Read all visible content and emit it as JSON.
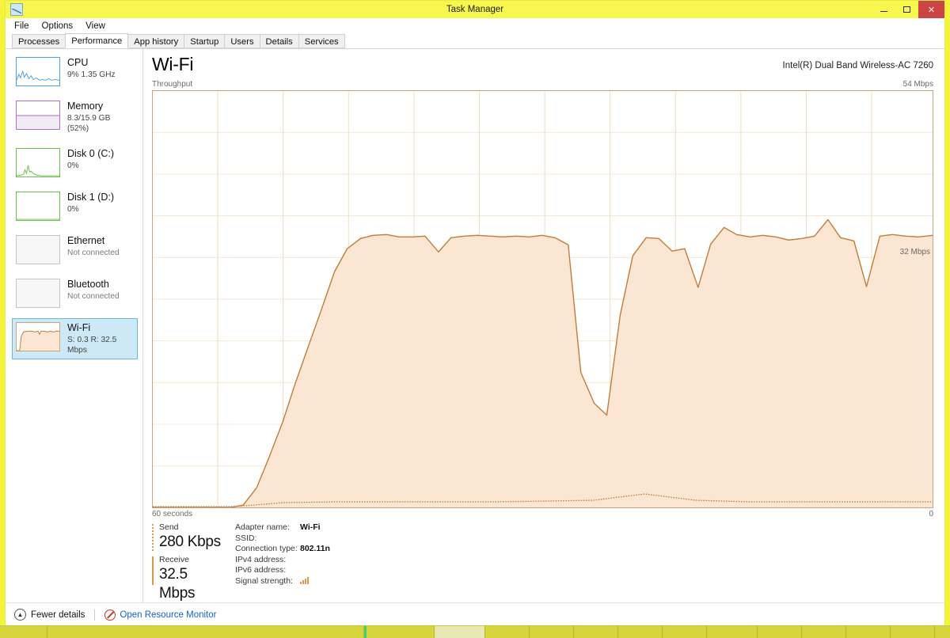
{
  "window": {
    "title": "Task Manager",
    "icon": "task-manager-icon",
    "minimize_label": "–",
    "maximize_label": "❑",
    "close_label": "✕"
  },
  "menu": {
    "items": [
      "File",
      "Options",
      "View"
    ]
  },
  "tabs": {
    "items": [
      "Processes",
      "Performance",
      "App history",
      "Startup",
      "Users",
      "Details",
      "Services"
    ],
    "active": "Performance"
  },
  "sidebar": {
    "items": [
      {
        "name": "CPU",
        "sub": "9%  1.35 GHz",
        "accent": "#4aa3df",
        "selected": false,
        "dim": false
      },
      {
        "name": "Memory",
        "sub": "8.3/15.9 GB (52%)",
        "accent": "#b06fc4",
        "selected": false,
        "dim": false
      },
      {
        "name": "Disk 0 (C:)",
        "sub": "0%",
        "accent": "#6abf4b",
        "selected": false,
        "dim": false
      },
      {
        "name": "Disk 1 (D:)",
        "sub": "0%",
        "accent": "#6abf4b",
        "selected": false,
        "dim": false
      },
      {
        "name": "Ethernet",
        "sub": "Not connected",
        "accent": "#bdbdbd",
        "selected": false,
        "dim": true
      },
      {
        "name": "Bluetooth",
        "sub": "Not connected",
        "accent": "#bdbdbd",
        "selected": false,
        "dim": true
      },
      {
        "name": "Wi-Fi",
        "sub": "S: 0.3 R: 32.5 Mbps",
        "accent": "#d99a4e",
        "selected": true,
        "dim": false
      }
    ]
  },
  "main": {
    "title": "Wi-Fi",
    "adapter": "Intel(R) Dual Band Wireless-AC 7260",
    "graph_caption_left": "Throughput",
    "graph_caption_right": "54 Mbps",
    "inline_label": "32 Mbps",
    "axis_left": "60 seconds",
    "axis_right": "0"
  },
  "stats": {
    "send": {
      "label": "Send",
      "value": "280 Kbps"
    },
    "receive": {
      "label": "Receive",
      "value": "32.5 Mbps"
    },
    "info": [
      {
        "key": "Adapter name:",
        "value": "Wi-Fi"
      },
      {
        "key": "SSID:",
        "value": ""
      },
      {
        "key": "Connection type:",
        "value": "802.11n"
      },
      {
        "key": "IPv4 address:",
        "value": ""
      },
      {
        "key": "IPv6 address:",
        "value": ""
      },
      {
        "key": "Signal strength:",
        "value": ""
      }
    ]
  },
  "statusbar": {
    "fewer_details": "Fewer details",
    "open_resource_monitor": "Open Resource Monitor"
  },
  "colors": {
    "line": "#c07c38",
    "fill": "#fbe6d4",
    "grid": "#f0dcc4",
    "border": "#c8a477",
    "accent_blue": "#1565c0",
    "selection": "#cde8f7",
    "titlebar": "#f7f74e",
    "close": "#cc4444"
  },
  "chart_data": {
    "type": "area",
    "title": "Throughput",
    "xlabel": "60 seconds",
    "ylabel": "Mbps",
    "ylim": [
      0,
      54
    ],
    "xlim": [
      0,
      60
    ],
    "grid": true,
    "legend": "none",
    "annotations": [
      {
        "text": "54 Mbps",
        "position": "top-right"
      },
      {
        "text": "32 Mbps",
        "position": "right",
        "value": 32
      },
      {
        "text": "60 seconds",
        "position": "bottom-left"
      },
      {
        "text": "0",
        "position": "bottom-right"
      }
    ],
    "series": [
      {
        "name": "Receive",
        "style": "area",
        "color": "#c07c38",
        "fill": "#fbe6d4",
        "x": [
          0,
          1,
          2,
          3,
          4,
          5,
          6,
          7,
          8,
          9,
          10,
          11,
          12,
          13,
          14,
          15,
          16,
          17,
          18,
          19,
          20,
          21,
          22,
          23,
          24,
          25,
          26,
          27,
          28,
          29,
          30,
          31,
          32,
          33,
          34,
          35,
          36,
          37,
          38,
          39,
          40,
          41,
          42,
          43,
          44,
          45,
          46,
          47,
          48,
          49,
          50,
          51,
          52,
          53,
          54,
          55,
          56,
          57,
          58,
          59,
          60
        ],
        "values": [
          0,
          0,
          0,
          0,
          0,
          0,
          0,
          0.3,
          2.5,
          6.5,
          11,
          16,
          21,
          26.5,
          30.5,
          31.8,
          32.2,
          32.3,
          32.0,
          31.9,
          32.0,
          33.1,
          31.9,
          32.1,
          32.2,
          32.1,
          32.0,
          32.1,
          32.0,
          32.2,
          31.9,
          31.0,
          17.5,
          13.5,
          12.0,
          25.0,
          32.6,
          32.1,
          32.4,
          32.6,
          32.4,
          28.5,
          32.5,
          34.5,
          32.6,
          32.4,
          32.5,
          32.3,
          31.8,
          32.0,
          32.3,
          34.2,
          32.1,
          31.7,
          28.6,
          32.3,
          32.5,
          32.3,
          32.2,
          32.1,
          32.3
        ]
      },
      {
        "name": "Send",
        "style": "dotted-line",
        "color": "#c07c38",
        "x": [
          0,
          5,
          10,
          12,
          14,
          16,
          20,
          25,
          30,
          35,
          40,
          44,
          46,
          48,
          52,
          56,
          60
        ],
        "values": [
          0,
          0,
          0,
          0.2,
          0.28,
          0.28,
          0.28,
          0.28,
          0.28,
          0.28,
          0.3,
          0.9,
          1.2,
          0.9,
          0.3,
          0.28,
          0.28
        ]
      }
    ]
  }
}
